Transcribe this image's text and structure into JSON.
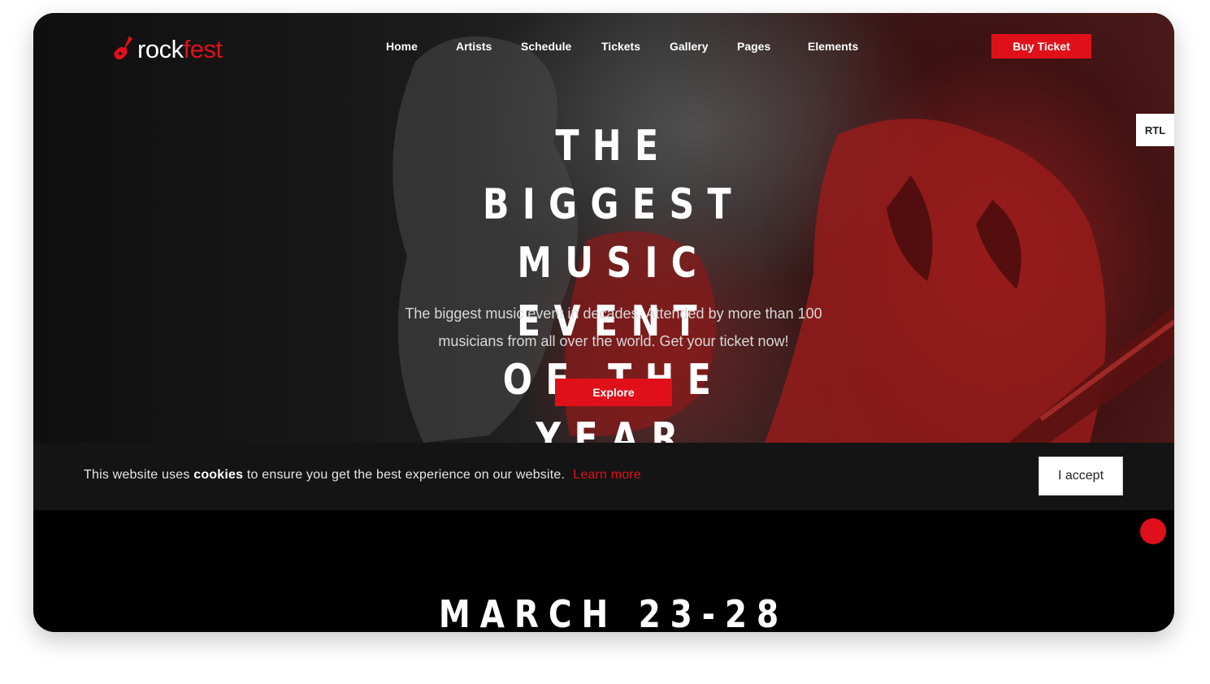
{
  "brand": {
    "name_part1": "rock",
    "name_part2": "fest",
    "accent": "#e0101a"
  },
  "nav": {
    "items": [
      {
        "label": "Home"
      },
      {
        "label": "Artists"
      },
      {
        "label": "Schedule"
      },
      {
        "label": "Tickets"
      },
      {
        "label": "Gallery"
      },
      {
        "label": "Pages"
      },
      {
        "label": "Elements"
      }
    ],
    "buy_ticket_label": "Buy Ticket"
  },
  "rtl_label": "RTL",
  "hero": {
    "headline_lines": [
      "THE BIGGEST",
      "MUSIC EVENT",
      "OF THE YEAR"
    ],
    "subtext_line1": "The biggest music event in decades. Attended by more than 100",
    "subtext_line2": "musicians from all over the world. Get your ticket now!",
    "cta_label": "Explore"
  },
  "cookie_banner": {
    "text_before": "This website uses ",
    "text_bold": "cookies",
    "text_after": " to ensure you get the best experience on our website.",
    "learn_more_label": "Learn more",
    "accept_label": "I accept"
  },
  "event": {
    "date": "MARCH 23-28"
  },
  "icons": {
    "logo": "guitar-icon",
    "scroll": "red-dot-icon"
  }
}
